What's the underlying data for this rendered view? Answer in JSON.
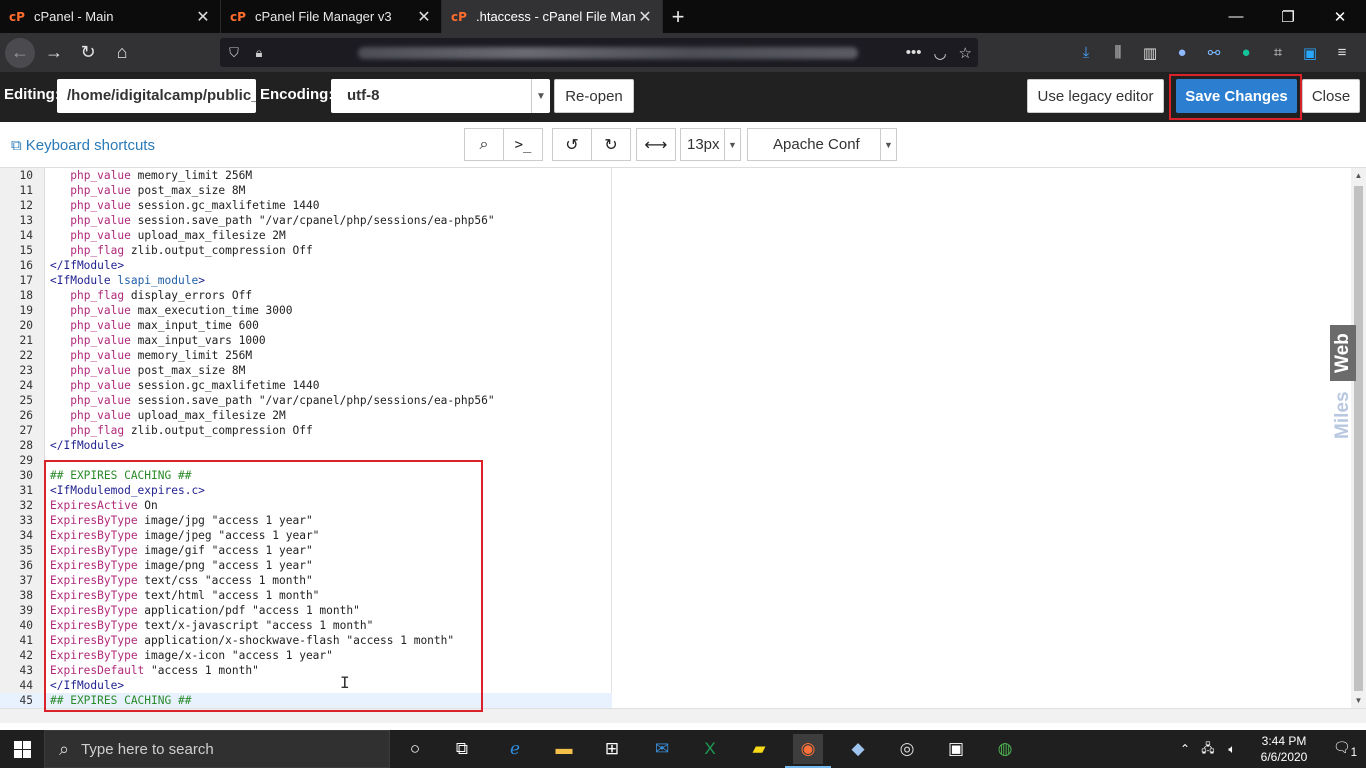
{
  "browser": {
    "tabs": [
      {
        "title": "cPanel - Main",
        "active": false
      },
      {
        "title": "cPanel File Manager v3",
        "active": false
      },
      {
        "title": ".htaccess - cPanel File Manager",
        "active": true
      }
    ],
    "new_tab_glyph": "+",
    "close_glyph": "✕"
  },
  "editor_header": {
    "editing_label": "Editing:",
    "path_value": "/home/idigitalcamp/public_html/.htaccess",
    "encoding_label": "Encoding:",
    "encoding_value": "utf-8",
    "reopen_label": "Re-open",
    "legacy_label": "Use legacy editor",
    "save_label": "Save Changes",
    "close_label": "Close"
  },
  "toolbar": {
    "keyboard_shortcuts": "Keyboard shortcuts",
    "font_size": "13px",
    "mode": "Apache Conf"
  },
  "code_lines": [
    {
      "n": "10",
      "indent": true,
      "kw": "php_value",
      "rest": " memory_limit 256M"
    },
    {
      "n": "11",
      "indent": true,
      "kw": "php_value",
      "rest": " post_max_size 8M"
    },
    {
      "n": "12",
      "indent": true,
      "kw": "php_value",
      "rest": " session.gc_maxlifetime 1440"
    },
    {
      "n": "13",
      "indent": true,
      "kw": "php_value",
      "rest": " session.save_path \"/var/cpanel/php/sessions/ea-php56\""
    },
    {
      "n": "14",
      "indent": true,
      "kw": "php_value",
      "rest": " upload_max_filesize 2M"
    },
    {
      "n": "15",
      "indent": true,
      "kw": "php_flag",
      "rest": " zlib.output_compression Off"
    },
    {
      "n": "16",
      "tag": "</IfModule>"
    },
    {
      "n": "17",
      "tag": "<IfModule ",
      "tagname": "lsapi_module",
      "tagend": ">"
    },
    {
      "n": "18",
      "indent": true,
      "kw": "php_flag",
      "rest": " display_errors Off"
    },
    {
      "n": "19",
      "indent": true,
      "kw": "php_value",
      "rest": " max_execution_time 3000"
    },
    {
      "n": "20",
      "indent": true,
      "kw": "php_value",
      "rest": " max_input_time 600"
    },
    {
      "n": "21",
      "indent": true,
      "kw": "php_value",
      "rest": " max_input_vars 1000"
    },
    {
      "n": "22",
      "indent": true,
      "kw": "php_value",
      "rest": " memory_limit 256M"
    },
    {
      "n": "23",
      "indent": true,
      "kw": "php_value",
      "rest": " post_max_size 8M"
    },
    {
      "n": "24",
      "indent": true,
      "kw": "php_value",
      "rest": " session.gc_maxlifetime 1440"
    },
    {
      "n": "25",
      "indent": true,
      "kw": "php_value",
      "rest": " session.save_path \"/var/cpanel/php/sessions/ea-php56\""
    },
    {
      "n": "26",
      "indent": true,
      "kw": "php_value",
      "rest": " upload_max_filesize 2M"
    },
    {
      "n": "27",
      "indent": true,
      "kw": "php_flag",
      "rest": " zlib.output_compression Off"
    },
    {
      "n": "28",
      "tag": "</IfModule>"
    },
    {
      "n": "29"
    },
    {
      "n": "30",
      "comment": "## EXPIRES CACHING ##"
    },
    {
      "n": "31",
      "tag": "<IfModulemod_expires.c>"
    },
    {
      "n": "32",
      "kw": "ExpiresActive",
      "rest": " On"
    },
    {
      "n": "33",
      "kw": "ExpiresByType",
      "rest": " image/jpg \"access 1 year\""
    },
    {
      "n": "34",
      "kw": "ExpiresByType",
      "rest": " image/jpeg \"access 1 year\""
    },
    {
      "n": "35",
      "kw": "ExpiresByType",
      "rest": " image/gif \"access 1 year\""
    },
    {
      "n": "36",
      "kw": "ExpiresByType",
      "rest": " image/png \"access 1 year\""
    },
    {
      "n": "37",
      "kw": "ExpiresByType",
      "rest": " text/css \"access 1 month\""
    },
    {
      "n": "38",
      "kw": "ExpiresByType",
      "rest": " text/html \"access 1 month\""
    },
    {
      "n": "39",
      "kw": "ExpiresByType",
      "rest": " application/pdf \"access 1 month\""
    },
    {
      "n": "40",
      "kw": "ExpiresByType",
      "rest": " text/x-javascript \"access 1 month\""
    },
    {
      "n": "41",
      "kw": "ExpiresByType",
      "rest": " application/x-shockwave-flash \"access 1 month\""
    },
    {
      "n": "42",
      "kw": "ExpiresByType",
      "rest": " image/x-icon \"access 1 year\""
    },
    {
      "n": "43",
      "kw": "ExpiresDefault",
      "rest": " \"access 1 month\""
    },
    {
      "n": "44",
      "tag": "</IfModule>"
    },
    {
      "n": "45",
      "comment": "## EXPIRES CACHING ##",
      "cursor": true
    }
  ],
  "watermark": {
    "part1": "Web",
    "part2": "Miles"
  },
  "taskbar": {
    "search_placeholder": "Type here to search",
    "time": "3:44 PM",
    "date": "6/6/2020",
    "notification_count": "1"
  },
  "colors": {
    "accent": "#2c7fd0",
    "highlight_box": "#d9222a",
    "keyword": "#b1297a",
    "comment": "#2a8a2a"
  }
}
